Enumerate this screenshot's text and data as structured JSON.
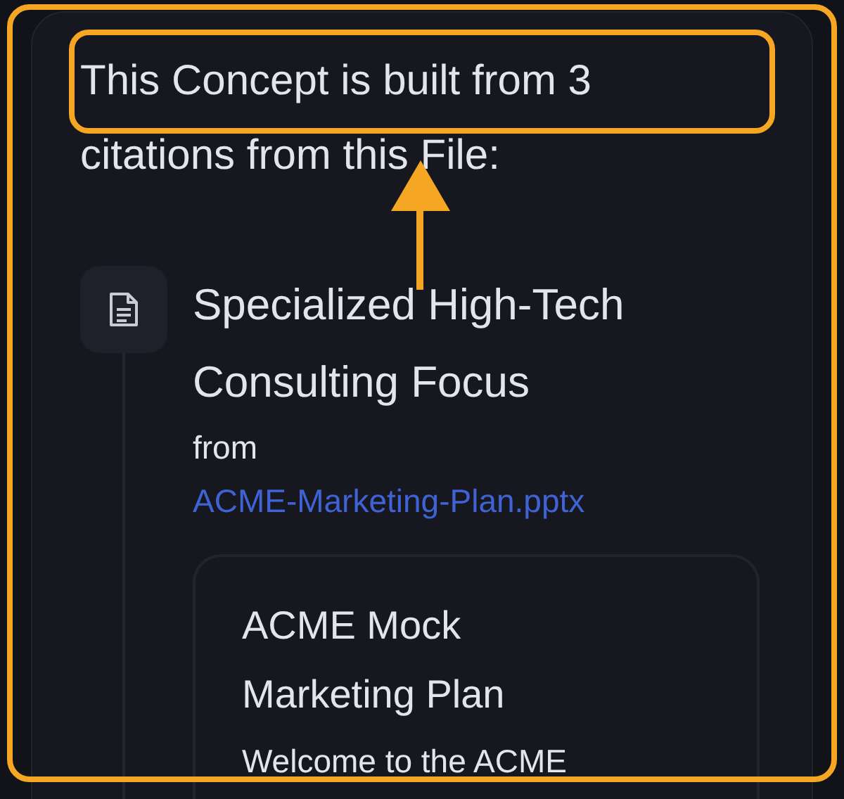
{
  "heading": {
    "highlighted": "This Concept is built from 3",
    "rest": "citations from this File:"
  },
  "citation": {
    "title": "Specialized High-Tech Consulting Focus",
    "from_label": "from",
    "file_link": "ACME-Marketing-Plan.pptx"
  },
  "preview": {
    "title": "ACME Mock Marketing Plan",
    "body": "Welcome to the ACME"
  }
}
